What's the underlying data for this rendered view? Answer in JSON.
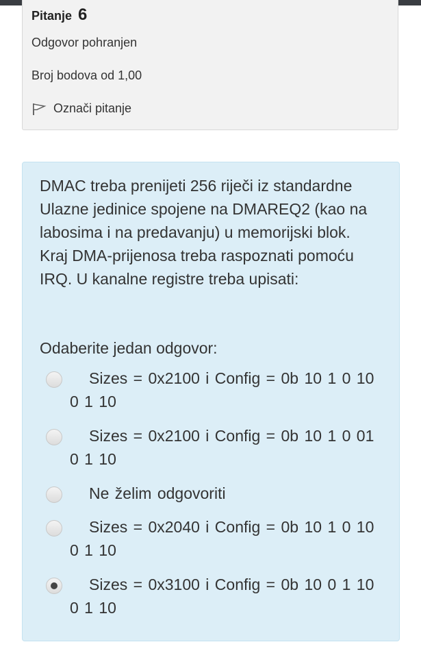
{
  "question_info": {
    "title": "Pitanje",
    "number": "6",
    "status": "Odgovor pohranjen",
    "points": "Broj bodova od 1,00",
    "flag_label": "Označi pitanje"
  },
  "question": {
    "text": "DMAC treba prenijeti 256 riječi iz standardne Ulazne jedinice spojene na DMAREQ2 (kao na labosima i na predavanju) u memorijski blok. Kraj DMA-prijenosa treba raspoznati pomoću IRQ. U kanalne registre treba upisati:",
    "prompt": "Odaberite jedan odgovor:",
    "options": [
      {
        "text": "Sizes = 0x2100  i  Config = 0b 10 1 0 10 0 1 10",
        "selected": false
      },
      {
        "text": "Sizes = 0x2100  i  Config = 0b 10 1 0 01 0 1 10",
        "selected": false
      },
      {
        "text": "Ne želim odgovoriti",
        "selected": false
      },
      {
        "text": "Sizes = 0x2040  i  Config = 0b 10 1 0 10 0 1 10",
        "selected": false
      },
      {
        "text": "Sizes = 0x3100  i  Config = 0b 10 0 1 10 0 1 10",
        "selected": true
      }
    ]
  },
  "colors": {
    "question_bg": "#dceef7",
    "info_bg": "#f2f2f2",
    "top_bar": "#3a3d42"
  }
}
